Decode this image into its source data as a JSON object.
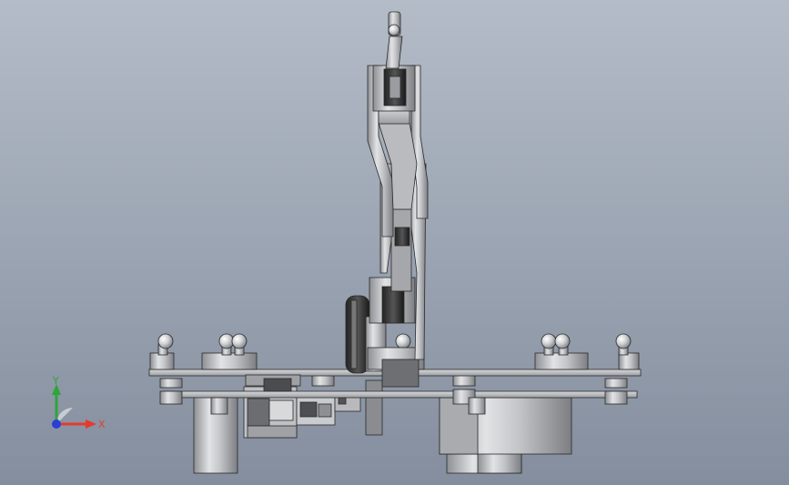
{
  "viewport": {
    "background_top": "#b4bcc8",
    "background_bottom": "#848e9e",
    "model": "robot-arm-assembly",
    "view": "front"
  },
  "triad": {
    "x_label": "X",
    "y_label": "Y",
    "x_color": "#e23b2e",
    "y_color": "#2fa43a",
    "z_color": "#2a3fd6"
  }
}
